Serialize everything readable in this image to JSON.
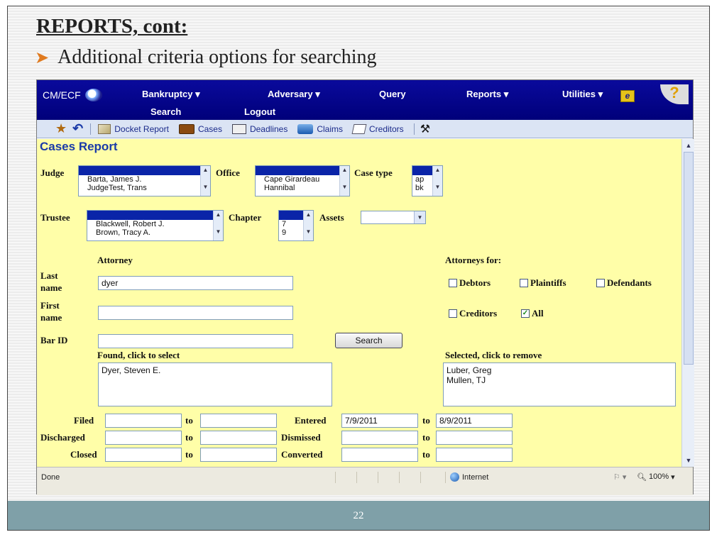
{
  "slide": {
    "title": "REPORTS, cont:",
    "bullet": "Additional criteria options for searching",
    "page_number": "22"
  },
  "nav": {
    "logo": "CM/ECF",
    "items": [
      "Bankruptcy ▾",
      "Adversary ▾",
      "Query",
      "Reports ▾",
      "Utilities ▾",
      "Search",
      "Logout"
    ]
  },
  "toolbar": {
    "items": [
      "Docket Report",
      "Cases",
      "Deadlines",
      "Claims",
      "Creditors"
    ]
  },
  "form": {
    "title": "Cases Report",
    "judge": {
      "label": "Judge",
      "options": [
        "Barta, James J.",
        "JudgeTest, Trans"
      ]
    },
    "office": {
      "label": "Office",
      "options": [
        "Cape Girardeau",
        "Hannibal"
      ]
    },
    "case_type": {
      "label": "Case type",
      "options": [
        "ap",
        "bk"
      ]
    },
    "trustee": {
      "label": "Trustee",
      "options": [
        "Blackwell, Robert J.",
        "Brown, Tracy A."
      ]
    },
    "chapter": {
      "label": "Chapter",
      "options": [
        "7",
        "9"
      ]
    },
    "assets": {
      "label": "Assets",
      "value": ""
    },
    "attorney_heading": "Attorney",
    "last_name": {
      "label1": "Last",
      "label2": "name",
      "value": "dyer"
    },
    "first_name": {
      "label1": "First",
      "label2": "name",
      "value": ""
    },
    "bar_id": {
      "label": "Bar ID",
      "value": ""
    },
    "search_button": "Search",
    "attorneys_for": {
      "heading": "Attorneys for:",
      "debtors": {
        "label": "Debtors",
        "checked": false
      },
      "plaintiffs": {
        "label": "Plaintiffs",
        "checked": false
      },
      "defendants": {
        "label": "Defendants",
        "checked": false
      },
      "creditors": {
        "label": "Creditors",
        "checked": false
      },
      "all": {
        "label": "All",
        "checked": true
      }
    },
    "found": {
      "heading": "Found, click to select",
      "items": [
        "Dyer, Steven E."
      ]
    },
    "selected": {
      "heading": "Selected, click to remove",
      "items": [
        "Luber, Greg",
        "Mullen, TJ"
      ]
    },
    "dates": {
      "to": "to",
      "filed": {
        "label": "Filed",
        "from": "",
        "to": ""
      },
      "discharged": {
        "label": "Discharged",
        "from": "",
        "to": ""
      },
      "closed": {
        "label": "Closed",
        "from": "",
        "to": ""
      },
      "entered": {
        "label": "Entered",
        "from": "7/9/2011",
        "to": "8/9/2011"
      },
      "dismissed": {
        "label": "Dismissed",
        "from": "",
        "to": ""
      },
      "converted": {
        "label": "Converted",
        "from": "",
        "to": ""
      }
    }
  },
  "status": {
    "left": "Done",
    "zone": "Internet",
    "zoom": "100%"
  },
  "colors": {
    "nav": "#0a0a9c",
    "content_bg": "#fffea8",
    "footer": "#7fa0a8",
    "bullet_arrow": "#e07a1f"
  }
}
